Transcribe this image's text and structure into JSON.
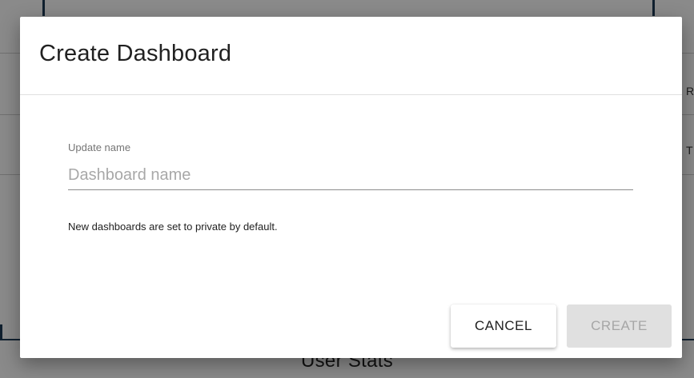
{
  "background": {
    "section_title": "User Stats",
    "column_label_1": "R",
    "column_label_2": "T"
  },
  "dialog": {
    "title": "Create Dashboard",
    "name_field": {
      "label": "Update name",
      "placeholder": "Dashboard name",
      "value": ""
    },
    "helper_text": "New dashboards are set to private by default.",
    "actions": {
      "cancel_label": "CANCEL",
      "create_label": "CREATE",
      "create_disabled": true
    }
  },
  "colors": {
    "scrim": "#000000",
    "dialog_background": "#ffffff",
    "disabled_button": "#e0e0e0",
    "background_accent": "#1f3b57"
  }
}
